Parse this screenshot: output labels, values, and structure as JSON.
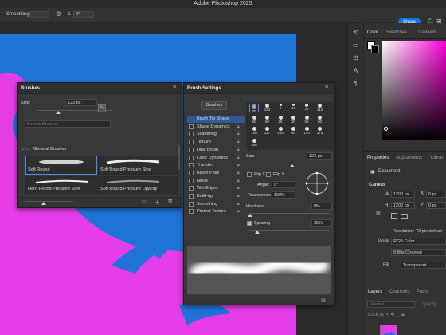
{
  "app": {
    "title": "Adobe Photoshop 2025"
  },
  "options_bar": {
    "smoothing_label": "Smoothing:",
    "angle_value": "0°",
    "share_label": "Share"
  },
  "right_panel": {
    "color_tabs": [
      "Color",
      "Swatches",
      "Gradients"
    ],
    "properties_tabs": [
      "Properties",
      "Adjustments",
      "Librari"
    ],
    "document_label": "Document",
    "canvas_section": "Canvas",
    "width_label": "W",
    "width_value": "1200 px",
    "height_label": "H",
    "height_value": "1200 px",
    "x_label": "X",
    "x_value": "0 px",
    "y_label": "Y",
    "y_value": "0 px",
    "resolution": "Resolution: 72 pixels/inch",
    "mode_label": "Mode",
    "mode_value": "RGB Color",
    "depth_value": "8 Bits/Channel",
    "fill_label": "Fill",
    "fill_value": "Transparent",
    "layers_tabs": [
      "Layers",
      "Channels",
      "Paths"
    ],
    "blend_value": "Normal",
    "opacity_label": "Opacity:",
    "lock_label": "Lock:"
  },
  "brushes_panel": {
    "title": "Brushes",
    "size_label": "Size:",
    "size_value": "123 px",
    "search_placeholder": "Search Brushes",
    "group_name": "General Brushes",
    "brushes": [
      "Soft Round",
      "Soft Round Pressure Size",
      "Hard Round Pressure Size",
      "Soft Round Pressure Opacity"
    ]
  },
  "brush_settings_panel": {
    "title": "Brush Settings",
    "brushes_button": "Brushes",
    "options": [
      {
        "label": "Brush Tip Shape",
        "checkbox": false,
        "selected": true
      },
      {
        "label": "Shape Dynamics",
        "checkbox": true,
        "checked": false
      },
      {
        "label": "Scattering",
        "checkbox": true,
        "checked": false
      },
      {
        "label": "Texture",
        "checkbox": true,
        "checked": false
      },
      {
        "label": "Dual Brush",
        "checkbox": true,
        "checked": false
      },
      {
        "label": "Color Dynamics",
        "checkbox": true,
        "checked": false
      },
      {
        "label": "Transfer",
        "checkbox": true,
        "checked": false
      },
      {
        "label": "Brush Pose",
        "checkbox": true,
        "checked": false
      },
      {
        "label": "Noise",
        "checkbox": true,
        "checked": false
      },
      {
        "label": "Wet Edges",
        "checkbox": true,
        "checked": false
      },
      {
        "label": "Build-up",
        "checkbox": true,
        "checked": false
      },
      {
        "label": "Smoothing",
        "checkbox": true,
        "checked": false
      },
      {
        "label": "Protect Texture",
        "checkbox": true,
        "checked": false
      }
    ],
    "tip_sizes": [
      [
        "30",
        "123",
        "8",
        "10",
        "25",
        "112"
      ],
      [
        "60",
        "50",
        "25",
        "30",
        "50",
        "60"
      ],
      [
        "100",
        "127",
        "284",
        "80",
        "174",
        "175"
      ],
      [
        "306",
        "",
        "",
        "",
        "",
        ""
      ]
    ],
    "size_label": "Size",
    "size_value": "123 px",
    "flip_x": "Flip X",
    "flip_y": "Flip Y",
    "angle_label": "Angle:",
    "angle_value": "0°",
    "roundness_label": "Roundness:",
    "roundness_value": "100%",
    "hardness_label": "Hardness",
    "hardness_value": "0%",
    "spacing_label": "Spacing",
    "spacing_value": "25%"
  },
  "colors": {
    "canvas_blue": "#1f74d8",
    "canvas_pink": "#e63de8",
    "accent": "#1473e6"
  },
  "icons": [
    "gear-icon",
    "bell-icon",
    "grid-icon",
    "link-icon",
    "lock-icon",
    "folder-icon",
    "trash-icon",
    "plus-icon",
    "menu-icon"
  ]
}
